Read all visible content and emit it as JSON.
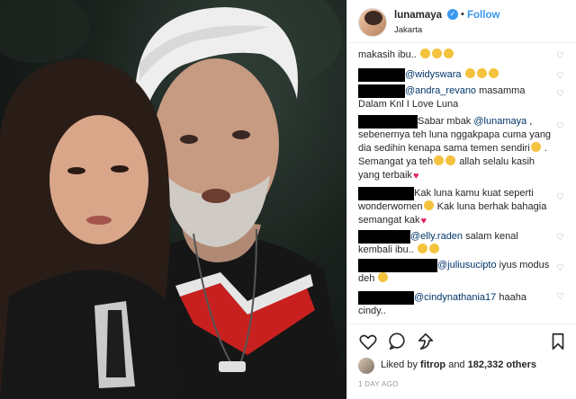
{
  "header": {
    "username": "lunamaya",
    "follow_label": "Follow",
    "separator": "•",
    "location": "Jakarta"
  },
  "comments": [
    {
      "text": "makasih ibu..",
      "emoji": [
        "raising-hands",
        "folded-hands",
        "folded-hands"
      ]
    },
    {
      "handle": "@widyswara",
      "text": "",
      "emoji": [
        "thumbs-up",
        "thumbs-up",
        "thumbs-up"
      ]
    },
    {
      "handle": "@andra_revano",
      "text": " masamma Dalam Knl I Love Luna"
    },
    {
      "text_a": "Sabar mbak ",
      "handle": "@lunamaya",
      "text_b": " , sebenernya teh luna nggakpapa cuma yang dia sedihin kenapa sama temen sendiri",
      "text_c": " . Semangat ya teh",
      "text_d": " allah selalu kasih yang terbaik"
    },
    {
      "text": "Kak luna kamu kuat seperti wonderwomen",
      "text_b": " Kak luna berhak bahagia semangat kak"
    },
    {
      "handle": "@elly.raden",
      "text": " salam kenal kembali ibu.."
    },
    {
      "handle": "@juliusucipto",
      "text": " iyus modus deh"
    },
    {
      "handle": "@cindynathania17",
      "text": " haaha cindy.."
    }
  ],
  "likes": {
    "prefix": "Liked by ",
    "user": "fitrop",
    "middle": " and ",
    "count": "182,332 others"
  },
  "time": "1 DAY AGO",
  "icons": [
    "heart-icon",
    "comment-icon",
    "share-icon",
    "bookmark-icon"
  ]
}
